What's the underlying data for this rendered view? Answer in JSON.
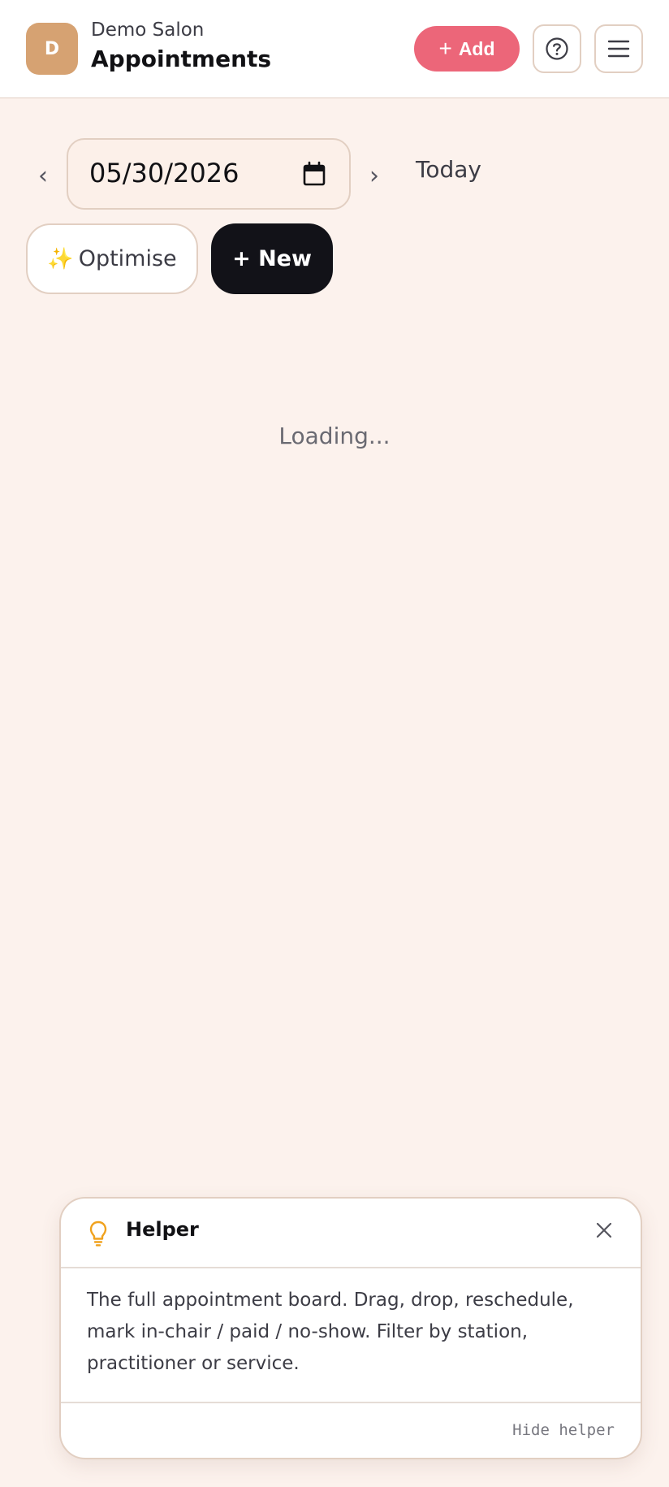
{
  "header": {
    "avatar_initial": "D",
    "salon_name": "Demo Salon",
    "page_title": "Appointments",
    "add_label": "Add",
    "help_icon": "question-circle-icon",
    "menu_icon": "hamburger-menu-icon"
  },
  "date_nav": {
    "prev_label": "‹",
    "next_label": "›",
    "date_value": "05/30/2026",
    "today_label": "Today"
  },
  "actions": {
    "optimise_icon": "✨",
    "optimise_label": "Optimise",
    "new_label": "+ New"
  },
  "status": {
    "loading_text": "Loading..."
  },
  "helper": {
    "title": "Helper",
    "body": "The full appointment board. Drag, drop, reschedule, mark in-chair / paid / no-show. Filter by station, practitioner or service.",
    "hide_label": "Hide helper"
  },
  "colors": {
    "accent_pink": "#ec6679",
    "avatar_tan": "#d6a272",
    "page_background": "#fcf2ed",
    "dark_button": "#121218",
    "bulb_orange": "#f0a21e"
  }
}
